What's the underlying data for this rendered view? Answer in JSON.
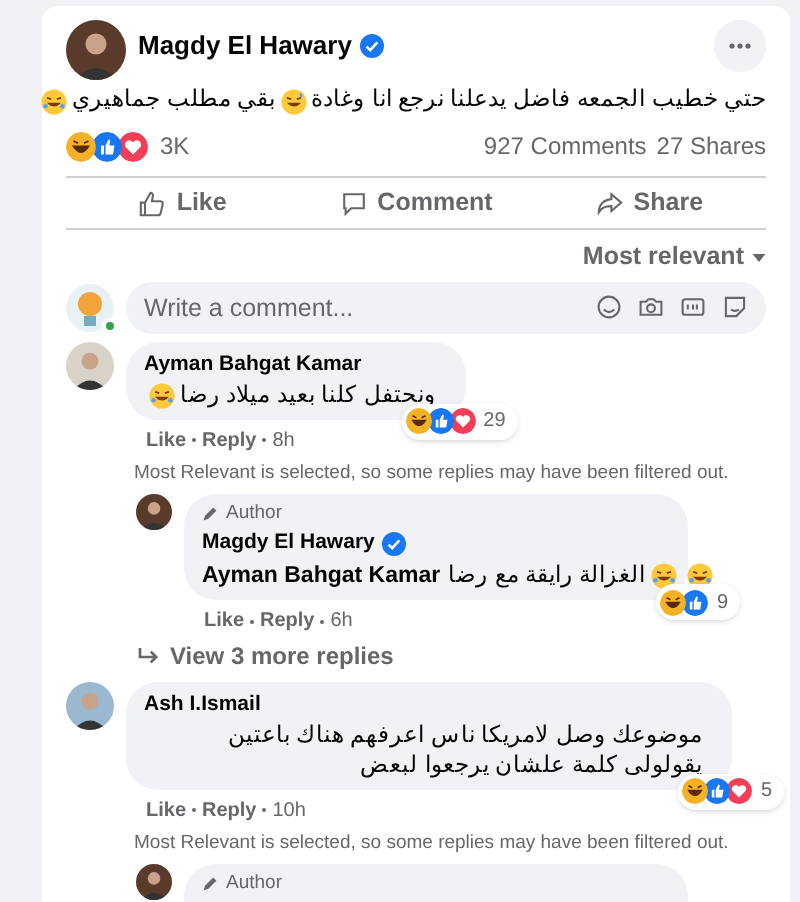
{
  "post": {
    "author": "Magdy El Hawary",
    "verified": true,
    "text": [
      {
        "kind": "text",
        "text": "حتي خطيب الجمعه فاضل يدعلنا نرجع انا وغادة"
      },
      {
        "kind": "sweat"
      },
      {
        "kind": "text",
        "text": "بقي مطلب جماهيري"
      },
      {
        "kind": "rofl"
      }
    ],
    "reactions": [
      {
        "kind": "haha"
      },
      {
        "kind": "like"
      },
      {
        "kind": "love"
      }
    ],
    "reaction_count": "3K",
    "comments_count": "927 Comments",
    "shares_count": "27 Shares"
  },
  "actions": [
    {
      "kind": "like",
      "label": "Like"
    },
    {
      "kind": "comment",
      "label": "Comment"
    },
    {
      "kind": "share",
      "label": "Share"
    }
  ],
  "sort": "Most relevant",
  "composer": {
    "placeholder": "Write a comment...",
    "online": true
  },
  "comments": [
    {
      "author": "Ayman Bahgat Kamar",
      "text": [
        {
          "kind": "text",
          "text": "ونحتفل كلنا بعيد ميلاد رضا"
        },
        {
          "kind": "rofl"
        }
      ],
      "reactions": [
        {
          "kind": "haha"
        },
        {
          "kind": "like"
        },
        {
          "kind": "love"
        }
      ],
      "reaction_count": "29",
      "like": "Like",
      "reply": "Reply",
      "time": "8h",
      "notice": "Most Relevant is selected, so some replies may have been filtered out.",
      "replies": [
        {
          "badge": "Author",
          "author": "Magdy El Hawary",
          "verified": true,
          "text": [
            {
              "kind": "mention",
              "text": "Ayman Bahgat Kamar"
            },
            {
              "kind": "text",
              "text": "الغزالة رايقة مع رضا"
            },
            {
              "kind": "rofl"
            },
            {
              "kind": "rofl"
            }
          ],
          "reactions": [
            {
              "kind": "haha"
            },
            {
              "kind": "like"
            }
          ],
          "reaction_count": "9",
          "like": "Like",
          "reply": "Reply",
          "time": "6h"
        }
      ],
      "more_replies": "View 3 more replies"
    },
    {
      "author": "Ash I.Ismail",
      "text": [
        {
          "kind": "text",
          "text": "موضوعك وصل لامريكا ناس اعرفهم هناك باعتين يقولولى كلمة علشان يرجعوا لبعض"
        }
      ],
      "reactions": [
        {
          "kind": "haha"
        },
        {
          "kind": "like"
        },
        {
          "kind": "love"
        }
      ],
      "reaction_count": "5",
      "like": "Like",
      "reply": "Reply",
      "time": "10h",
      "notice": "Most Relevant is selected, so some replies may have been filtered out.",
      "replies": [
        {
          "badge": "Author"
        }
      ]
    }
  ]
}
